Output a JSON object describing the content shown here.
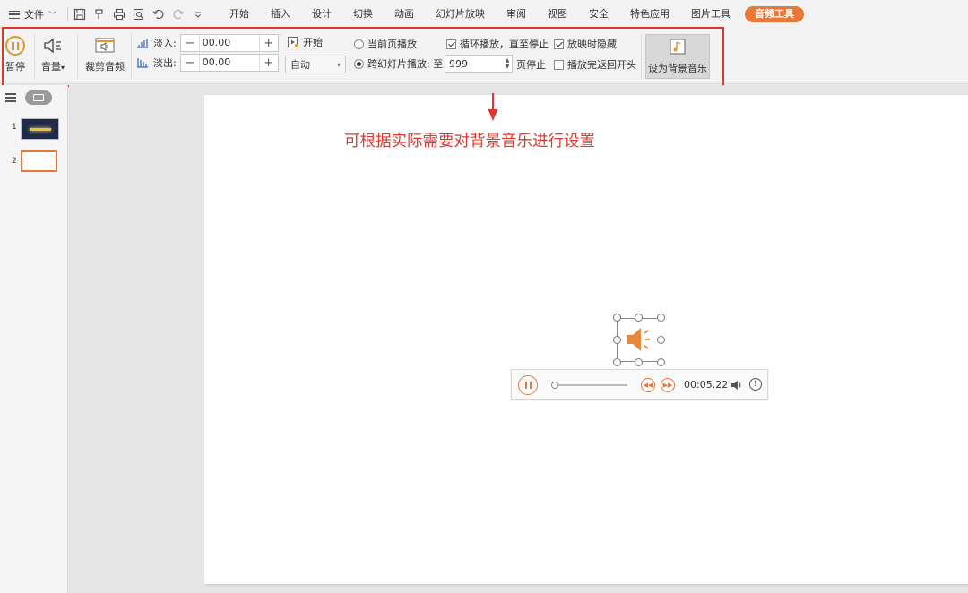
{
  "menubar": {
    "file_label": "文件",
    "tabs": [
      "开始",
      "插入",
      "设计",
      "切换",
      "动画",
      "幻灯片放映",
      "审阅",
      "视图",
      "安全",
      "特色应用",
      "图片工具"
    ],
    "active_tab": "音频工具"
  },
  "ribbon": {
    "pause_label": "暂停",
    "volume_label": "音量",
    "trim_label": "裁剪音频",
    "fade_in_label": "淡入:",
    "fade_in_value": "00.00",
    "fade_out_label": "淡出:",
    "fade_out_value": "00.00",
    "start_label": "开始",
    "start_select": "自动",
    "current_page_label": "当前页播放",
    "cross_slide_label": "跨幻灯片播放: 至",
    "cross_slide_value": "999",
    "page_stop_label": "页停止",
    "loop_label": "循环播放，直至停止",
    "hide_label": "放映时隐藏",
    "rewind_label": "播放完返回开头",
    "bg_music_label": "设为背景音乐"
  },
  "states": {
    "current_page": false,
    "cross_slide": true,
    "loop": true,
    "hide": true,
    "rewind": false
  },
  "slides": {
    "numbers": [
      "1",
      "2"
    ],
    "selected": 2
  },
  "annotation": "可根据实际需要对背景音乐进行设置",
  "player": {
    "time": "00:05.22",
    "progress": 0.0
  },
  "colors": {
    "accent": "#e8773a",
    "highlight": "#e0362e",
    "pause_icon": "#e0962e"
  }
}
